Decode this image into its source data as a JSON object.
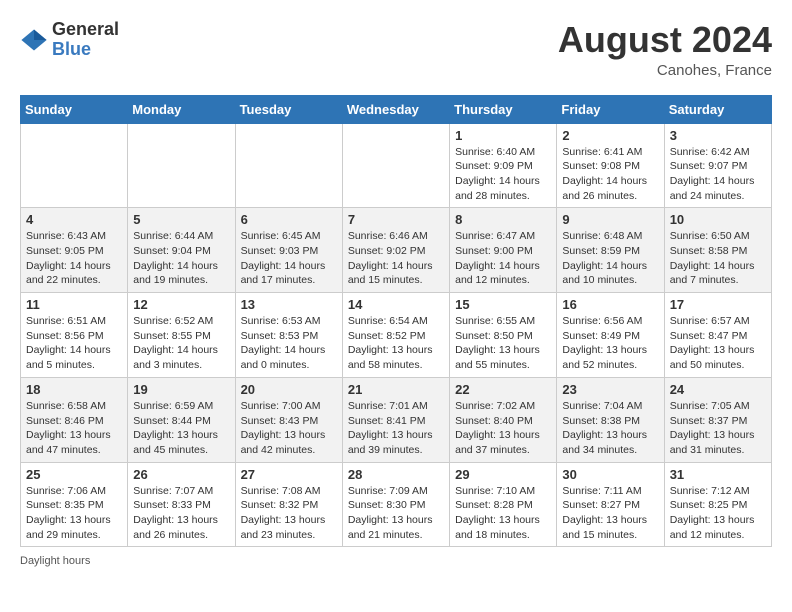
{
  "header": {
    "logo_general": "General",
    "logo_blue": "Blue",
    "month_year": "August 2024",
    "location": "Canohes, France"
  },
  "footer": {
    "daylight_label": "Daylight hours"
  },
  "days_of_week": [
    "Sunday",
    "Monday",
    "Tuesday",
    "Wednesday",
    "Thursday",
    "Friday",
    "Saturday"
  ],
  "weeks": [
    [
      {
        "day": "",
        "sunrise": "",
        "sunset": "",
        "daylight": ""
      },
      {
        "day": "",
        "sunrise": "",
        "sunset": "",
        "daylight": ""
      },
      {
        "day": "",
        "sunrise": "",
        "sunset": "",
        "daylight": ""
      },
      {
        "day": "",
        "sunrise": "",
        "sunset": "",
        "daylight": ""
      },
      {
        "day": "1",
        "sunrise": "Sunrise: 6:40 AM",
        "sunset": "Sunset: 9:09 PM",
        "daylight": "Daylight: 14 hours and 28 minutes."
      },
      {
        "day": "2",
        "sunrise": "Sunrise: 6:41 AM",
        "sunset": "Sunset: 9:08 PM",
        "daylight": "Daylight: 14 hours and 26 minutes."
      },
      {
        "day": "3",
        "sunrise": "Sunrise: 6:42 AM",
        "sunset": "Sunset: 9:07 PM",
        "daylight": "Daylight: 14 hours and 24 minutes."
      }
    ],
    [
      {
        "day": "4",
        "sunrise": "Sunrise: 6:43 AM",
        "sunset": "Sunset: 9:05 PM",
        "daylight": "Daylight: 14 hours and 22 minutes."
      },
      {
        "day": "5",
        "sunrise": "Sunrise: 6:44 AM",
        "sunset": "Sunset: 9:04 PM",
        "daylight": "Daylight: 14 hours and 19 minutes."
      },
      {
        "day": "6",
        "sunrise": "Sunrise: 6:45 AM",
        "sunset": "Sunset: 9:03 PM",
        "daylight": "Daylight: 14 hours and 17 minutes."
      },
      {
        "day": "7",
        "sunrise": "Sunrise: 6:46 AM",
        "sunset": "Sunset: 9:02 PM",
        "daylight": "Daylight: 14 hours and 15 minutes."
      },
      {
        "day": "8",
        "sunrise": "Sunrise: 6:47 AM",
        "sunset": "Sunset: 9:00 PM",
        "daylight": "Daylight: 14 hours and 12 minutes."
      },
      {
        "day": "9",
        "sunrise": "Sunrise: 6:48 AM",
        "sunset": "Sunset: 8:59 PM",
        "daylight": "Daylight: 14 hours and 10 minutes."
      },
      {
        "day": "10",
        "sunrise": "Sunrise: 6:50 AM",
        "sunset": "Sunset: 8:58 PM",
        "daylight": "Daylight: 14 hours and 7 minutes."
      }
    ],
    [
      {
        "day": "11",
        "sunrise": "Sunrise: 6:51 AM",
        "sunset": "Sunset: 8:56 PM",
        "daylight": "Daylight: 14 hours and 5 minutes."
      },
      {
        "day": "12",
        "sunrise": "Sunrise: 6:52 AM",
        "sunset": "Sunset: 8:55 PM",
        "daylight": "Daylight: 14 hours and 3 minutes."
      },
      {
        "day": "13",
        "sunrise": "Sunrise: 6:53 AM",
        "sunset": "Sunset: 8:53 PM",
        "daylight": "Daylight: 14 hours and 0 minutes."
      },
      {
        "day": "14",
        "sunrise": "Sunrise: 6:54 AM",
        "sunset": "Sunset: 8:52 PM",
        "daylight": "Daylight: 13 hours and 58 minutes."
      },
      {
        "day": "15",
        "sunrise": "Sunrise: 6:55 AM",
        "sunset": "Sunset: 8:50 PM",
        "daylight": "Daylight: 13 hours and 55 minutes."
      },
      {
        "day": "16",
        "sunrise": "Sunrise: 6:56 AM",
        "sunset": "Sunset: 8:49 PM",
        "daylight": "Daylight: 13 hours and 52 minutes."
      },
      {
        "day": "17",
        "sunrise": "Sunrise: 6:57 AM",
        "sunset": "Sunset: 8:47 PM",
        "daylight": "Daylight: 13 hours and 50 minutes."
      }
    ],
    [
      {
        "day": "18",
        "sunrise": "Sunrise: 6:58 AM",
        "sunset": "Sunset: 8:46 PM",
        "daylight": "Daylight: 13 hours and 47 minutes."
      },
      {
        "day": "19",
        "sunrise": "Sunrise: 6:59 AM",
        "sunset": "Sunset: 8:44 PM",
        "daylight": "Daylight: 13 hours and 45 minutes."
      },
      {
        "day": "20",
        "sunrise": "Sunrise: 7:00 AM",
        "sunset": "Sunset: 8:43 PM",
        "daylight": "Daylight: 13 hours and 42 minutes."
      },
      {
        "day": "21",
        "sunrise": "Sunrise: 7:01 AM",
        "sunset": "Sunset: 8:41 PM",
        "daylight": "Daylight: 13 hours and 39 minutes."
      },
      {
        "day": "22",
        "sunrise": "Sunrise: 7:02 AM",
        "sunset": "Sunset: 8:40 PM",
        "daylight": "Daylight: 13 hours and 37 minutes."
      },
      {
        "day": "23",
        "sunrise": "Sunrise: 7:04 AM",
        "sunset": "Sunset: 8:38 PM",
        "daylight": "Daylight: 13 hours and 34 minutes."
      },
      {
        "day": "24",
        "sunrise": "Sunrise: 7:05 AM",
        "sunset": "Sunset: 8:37 PM",
        "daylight": "Daylight: 13 hours and 31 minutes."
      }
    ],
    [
      {
        "day": "25",
        "sunrise": "Sunrise: 7:06 AM",
        "sunset": "Sunset: 8:35 PM",
        "daylight": "Daylight: 13 hours and 29 minutes."
      },
      {
        "day": "26",
        "sunrise": "Sunrise: 7:07 AM",
        "sunset": "Sunset: 8:33 PM",
        "daylight": "Daylight: 13 hours and 26 minutes."
      },
      {
        "day": "27",
        "sunrise": "Sunrise: 7:08 AM",
        "sunset": "Sunset: 8:32 PM",
        "daylight": "Daylight: 13 hours and 23 minutes."
      },
      {
        "day": "28",
        "sunrise": "Sunrise: 7:09 AM",
        "sunset": "Sunset: 8:30 PM",
        "daylight": "Daylight: 13 hours and 21 minutes."
      },
      {
        "day": "29",
        "sunrise": "Sunrise: 7:10 AM",
        "sunset": "Sunset: 8:28 PM",
        "daylight": "Daylight: 13 hours and 18 minutes."
      },
      {
        "day": "30",
        "sunrise": "Sunrise: 7:11 AM",
        "sunset": "Sunset: 8:27 PM",
        "daylight": "Daylight: 13 hours and 15 minutes."
      },
      {
        "day": "31",
        "sunrise": "Sunrise: 7:12 AM",
        "sunset": "Sunset: 8:25 PM",
        "daylight": "Daylight: 13 hours and 12 minutes."
      }
    ]
  ]
}
